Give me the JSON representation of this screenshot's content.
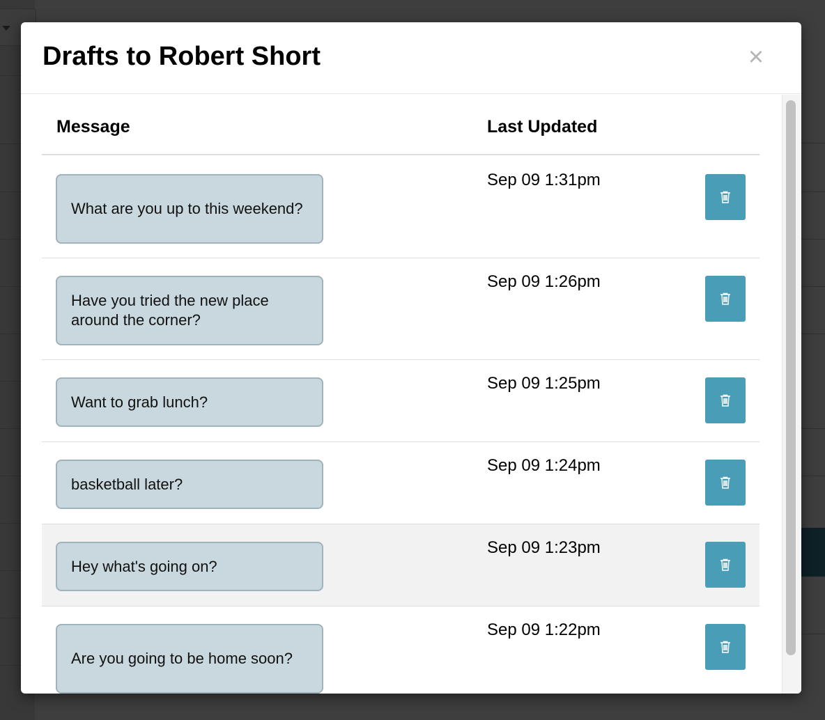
{
  "modal": {
    "title": "Drafts to Robert Short",
    "close_glyph": "×"
  },
  "table": {
    "columns": [
      "Message",
      "Last Updated"
    ]
  },
  "drafts": [
    {
      "message": "What are you up to this weekend?",
      "updated": "Sep 09 1:31pm"
    },
    {
      "message": "Have you tried the new place around the corner?",
      "updated": "Sep 09 1:26pm"
    },
    {
      "message": "Want to grab lunch?",
      "updated": "Sep 09 1:25pm"
    },
    {
      "message": "basketball later?",
      "updated": "Sep 09 1:24pm"
    },
    {
      "message": "Hey what's going on?",
      "updated": "Sep 09 1:23pm"
    },
    {
      "message": "Are you going to be home soon?",
      "updated": "Sep 09 1:22pm"
    }
  ],
  "colors": {
    "bubble_bg": "#c9d8de",
    "delete_button": "#4a9db7",
    "hover_row": "#f2f2f2"
  },
  "icons": {
    "delete": "trash-icon",
    "close": "close-icon"
  }
}
